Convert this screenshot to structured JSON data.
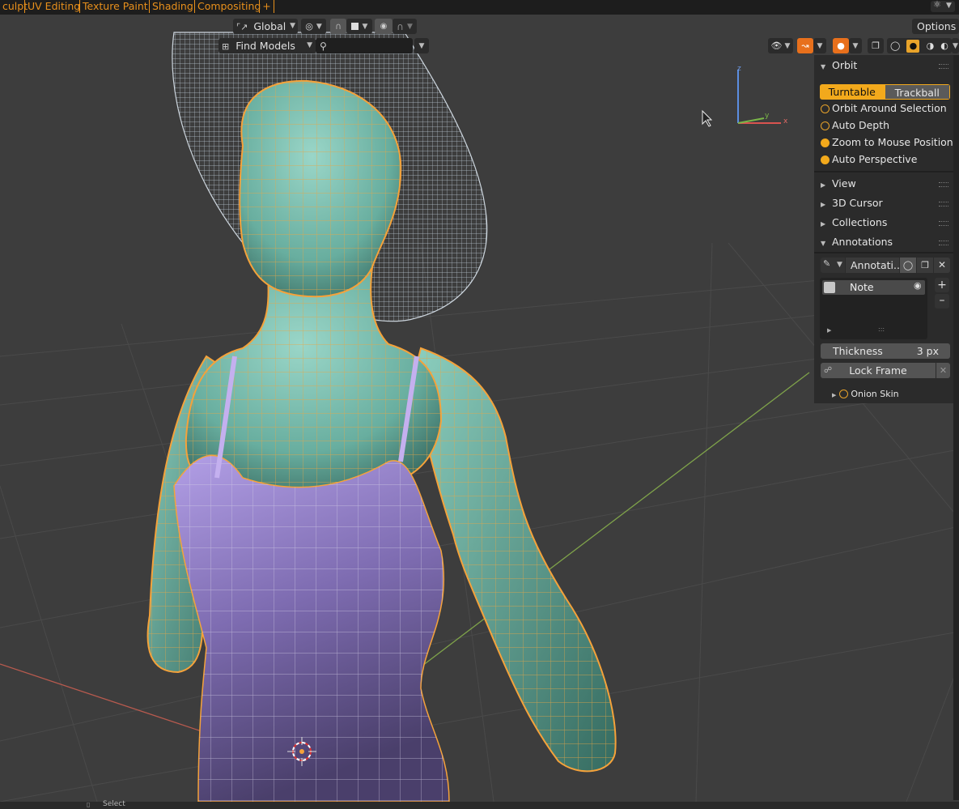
{
  "workspace_tabs": [
    "culpt",
    "UV Editing",
    "Texture Paint",
    "Shading",
    "Compositing",
    "+"
  ],
  "header": {
    "transform_orientation": "Global",
    "options_label": "Options",
    "find_label": "Find Models",
    "search_value": ""
  },
  "gizmo": {
    "z": "z",
    "y": "y",
    "x": "x"
  },
  "panel": {
    "orbit": {
      "title": "Orbit",
      "turntable": "Turntable",
      "trackball": "Trackball",
      "orbit_around_selection": "Orbit Around Selection",
      "auto_depth": "Auto Depth",
      "zoom_to_mouse": "Zoom to Mouse Position",
      "auto_perspective": "Auto Perspective"
    },
    "view": "View",
    "cursor": "3D Cursor",
    "collections": "Collections",
    "annotations": {
      "title": "Annotations",
      "datablock": "Annotati...",
      "layer": "Note",
      "thickness_label": "Thickness",
      "thickness_value": "3 px",
      "lock_frame": "Lock Frame",
      "onion_skin": "Onion Skin"
    }
  },
  "status": {
    "select": "Select"
  },
  "colors": {
    "accent": "#e8901c",
    "selected_outline": "#f5a23a",
    "body": "#6fb8a8",
    "dress": "#8f7ec4",
    "viewport": "#3d3d3d"
  }
}
